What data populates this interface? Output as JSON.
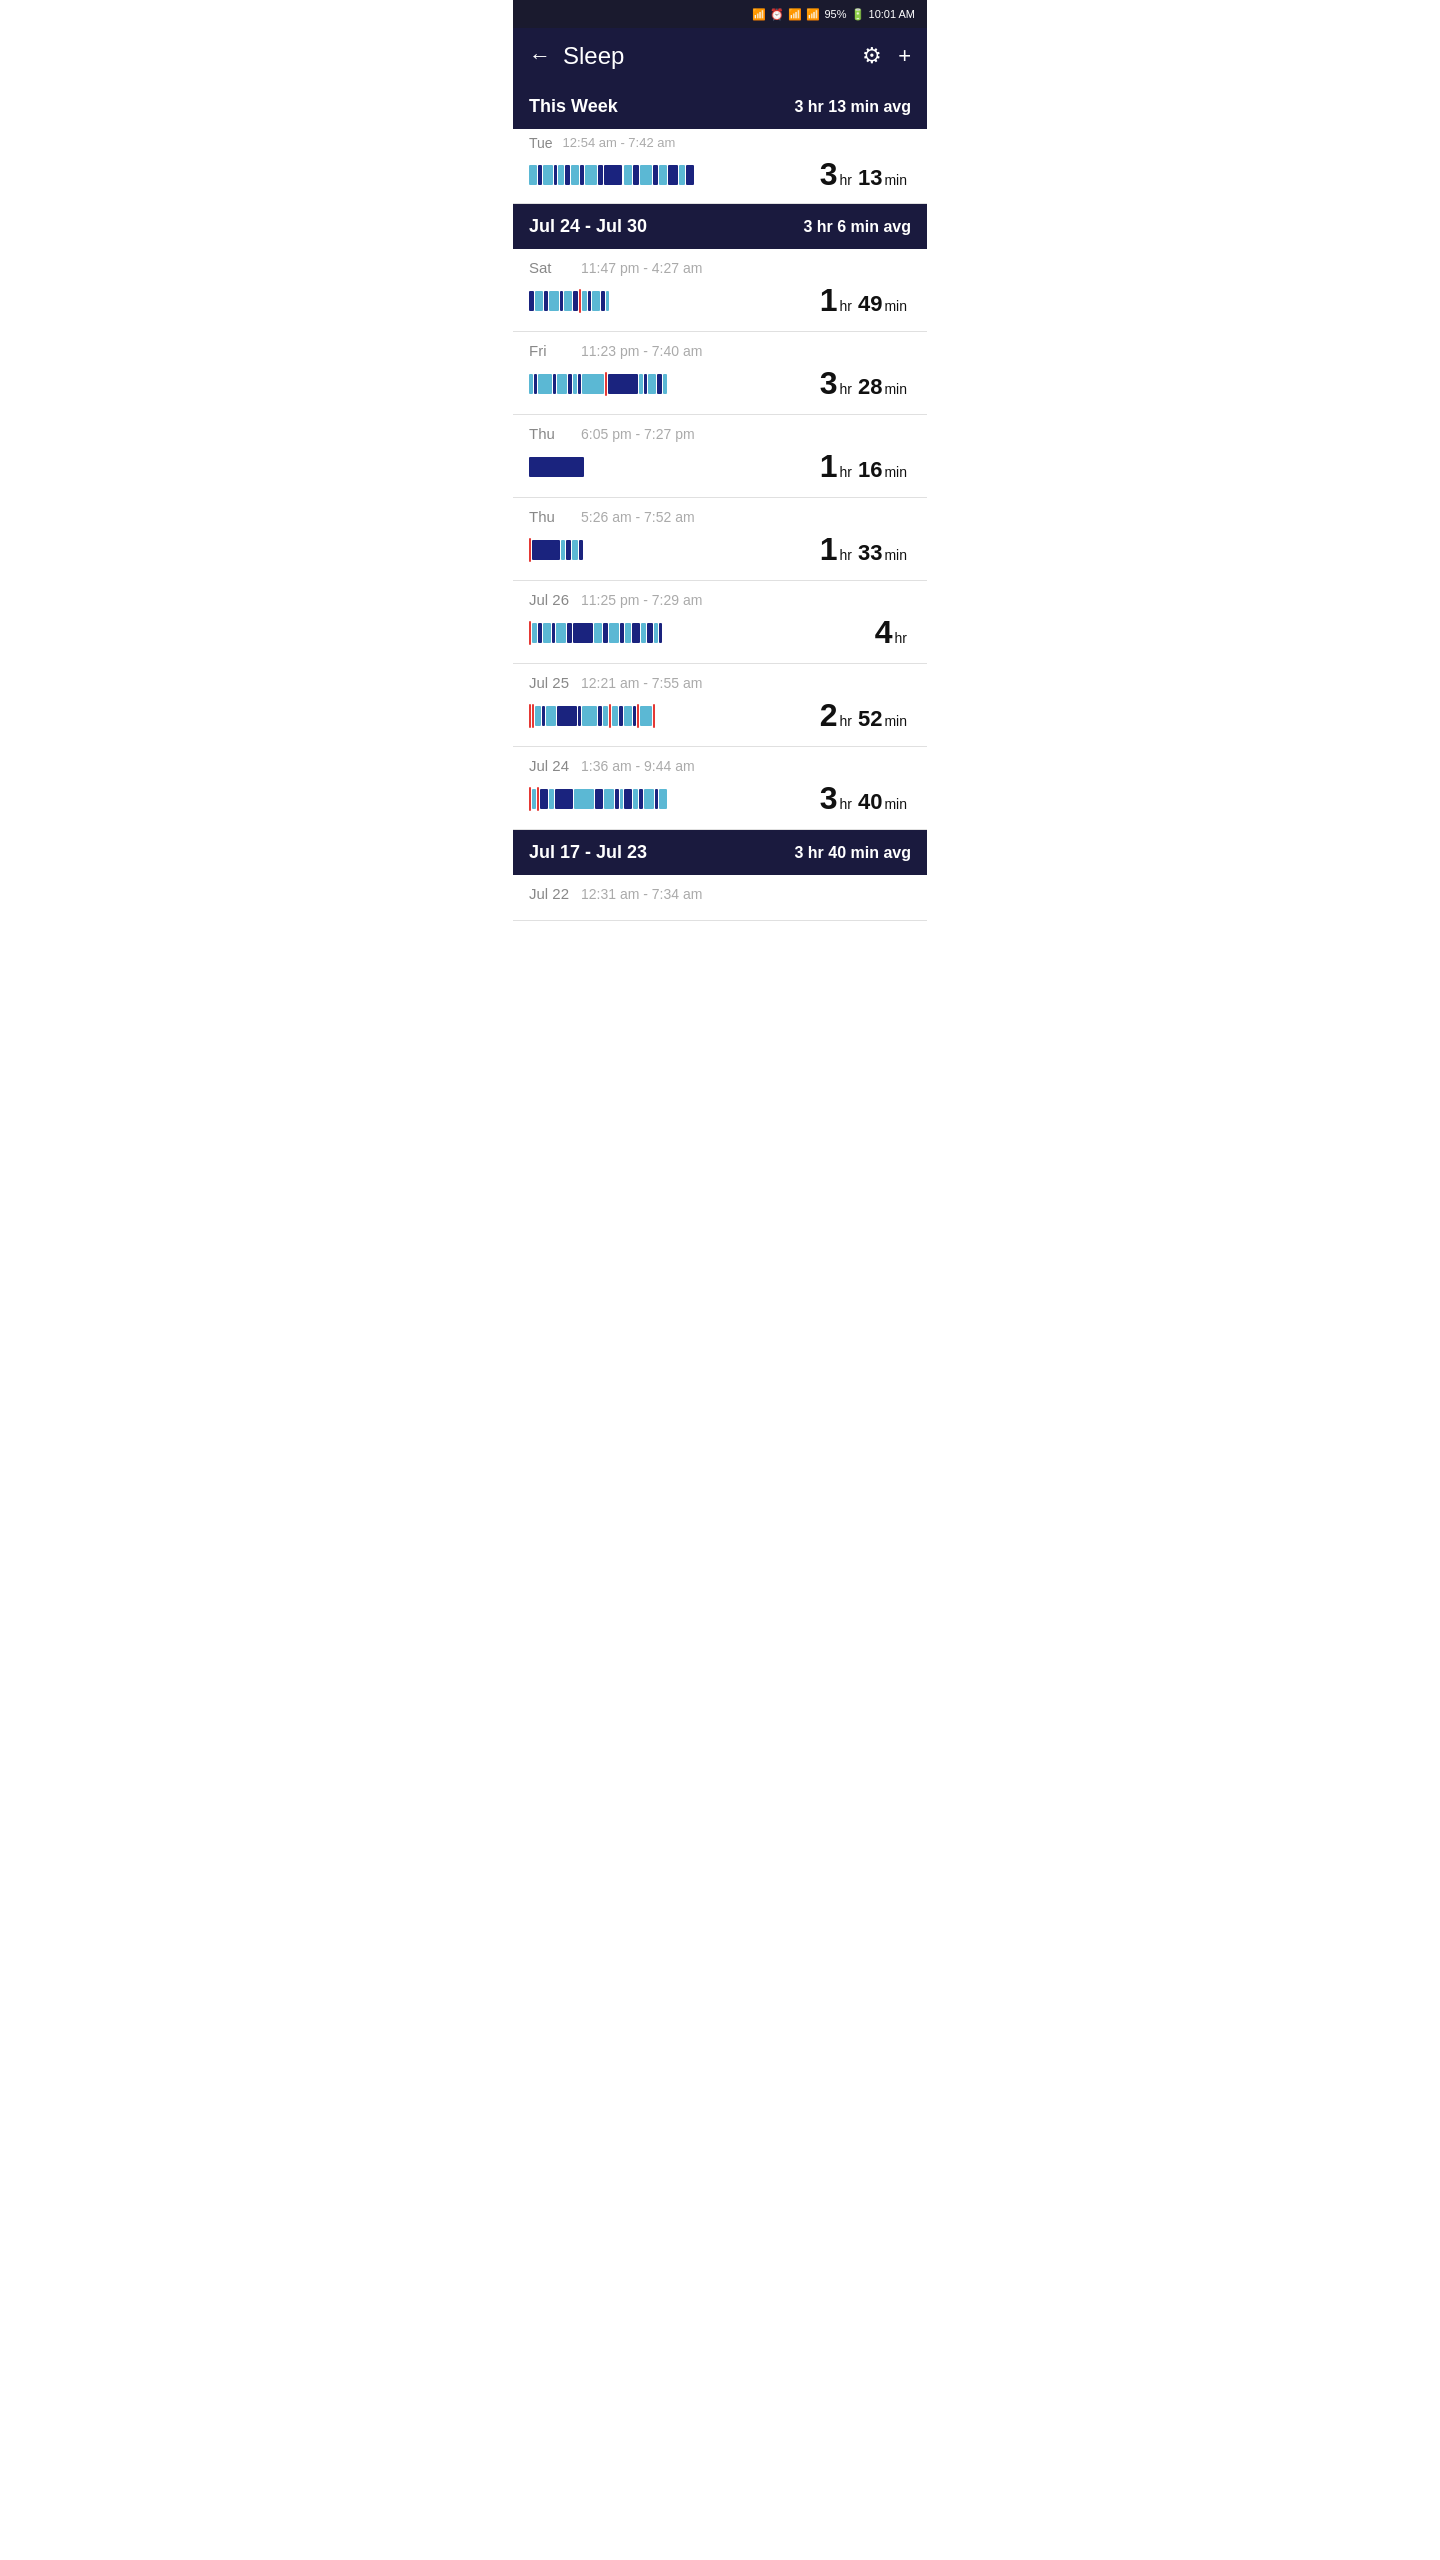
{
  "status_bar": {
    "icons": "🔵 ⏰ 📶 📶 📶 95%",
    "battery": "95%",
    "time": "10:01 AM"
  },
  "header": {
    "back_label": "←",
    "title": "Sleep",
    "settings_label": "⚙",
    "add_label": "+"
  },
  "this_week": {
    "label": "This Week",
    "avg": "3 hr 13 min avg"
  },
  "partial_entry": {
    "day": "Tue",
    "time": "12:54 am - 7:42 am",
    "duration_hr": "3",
    "duration_unit_hr": "hr",
    "duration_min": "13",
    "duration_unit_min": "min"
  },
  "weeks": [
    {
      "range": "Jul 24 - Jul 30",
      "avg": "3 hr 6 min avg",
      "entries": [
        {
          "day": "Sat",
          "time": "11:47 pm - 4:27 am",
          "duration_hr": "1",
          "duration_min": "49",
          "bar_type": "short_mixed"
        },
        {
          "day": "Fri",
          "time": "11:23 pm - 7:40 am",
          "duration_hr": "3",
          "duration_min": "28",
          "bar_type": "long_mixed"
        },
        {
          "day": "Thu",
          "time": "6:05 pm - 7:27 pm",
          "duration_hr": "1",
          "duration_min": "16",
          "bar_type": "very_short"
        },
        {
          "day": "Thu",
          "time": "5:26 am - 7:52 am",
          "duration_hr": "1",
          "duration_min": "33",
          "bar_type": "short_red_start"
        },
        {
          "day": "Jul 26",
          "time": "11:25 pm - 7:29 am",
          "duration_hr": "4",
          "duration_min": "",
          "bar_type": "long_red_start"
        },
        {
          "day": "Jul 25",
          "time": "12:21 am - 7:55 am",
          "duration_hr": "2",
          "duration_min": "52",
          "bar_type": "long_mixed_red"
        },
        {
          "day": "Jul 24",
          "time": "1:36 am - 9:44 am",
          "duration_hr": "3",
          "duration_min": "40",
          "bar_type": "long_mixed_red2"
        }
      ]
    },
    {
      "range": "Jul 17 - Jul 23",
      "avg": "3 hr 40 min avg",
      "entries": [
        {
          "day": "Jul 22",
          "time": "12:31 am - 7:34 am",
          "duration_hr": "",
          "duration_min": "",
          "bar_type": "partial_bottom"
        }
      ]
    }
  ]
}
